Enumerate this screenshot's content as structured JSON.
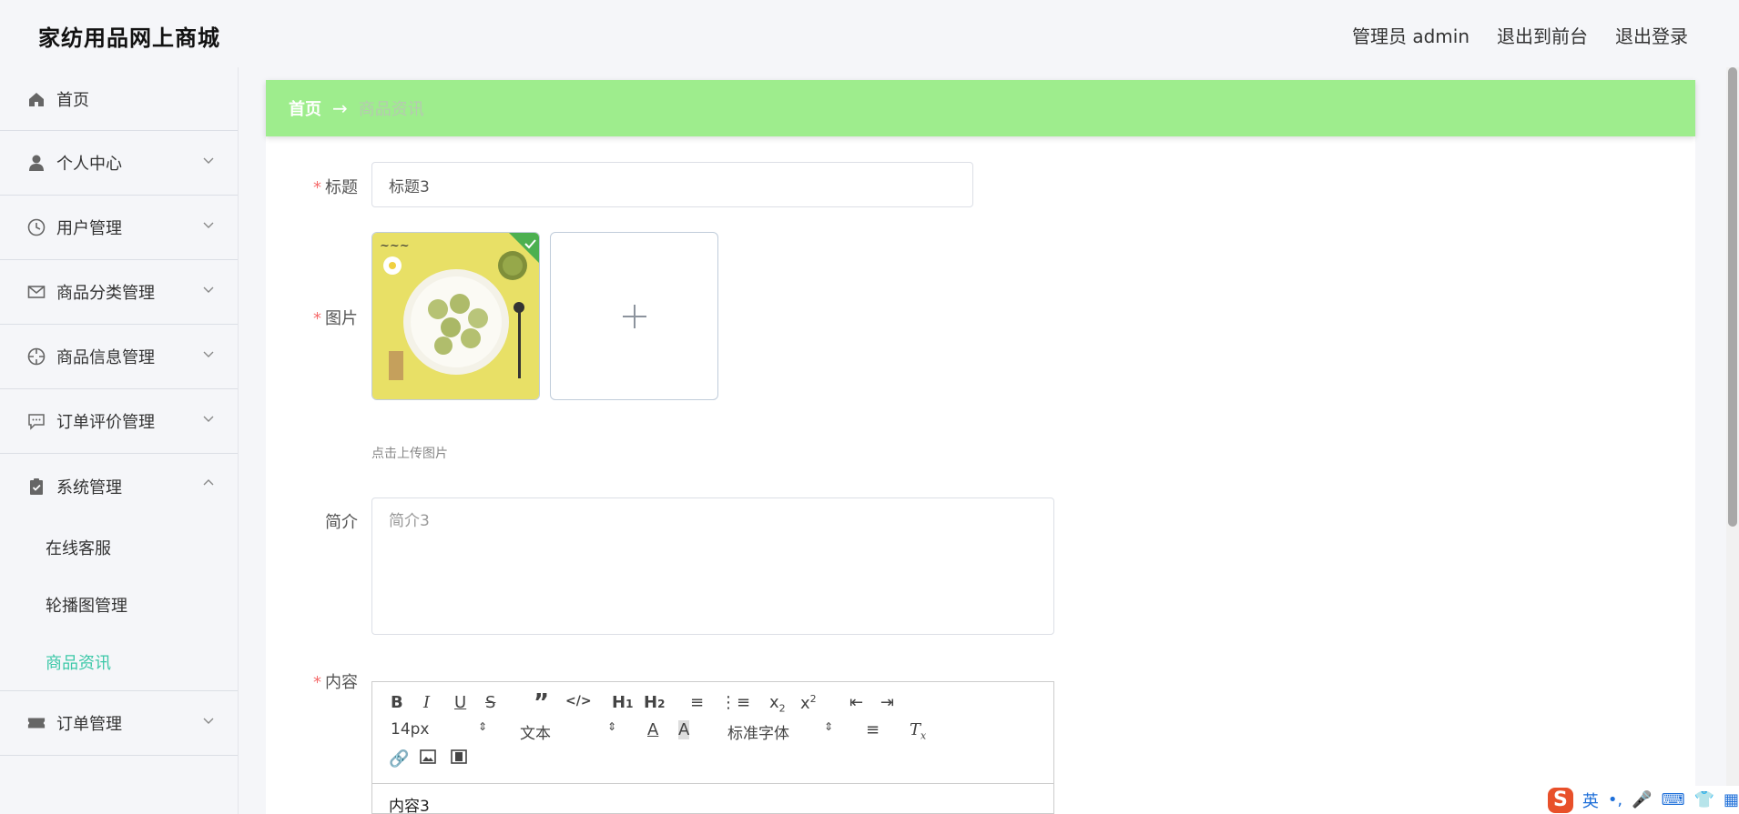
{
  "header": {
    "title": "家纺用品网上商城",
    "admin_label": "管理员 admin",
    "front_label": "退出到前台",
    "logout_label": "退出登录"
  },
  "sidebar": {
    "items": [
      {
        "label": "首页",
        "icon": "home-icon"
      },
      {
        "label": "个人中心",
        "icon": "user-icon"
      },
      {
        "label": "用户管理",
        "icon": "clock-icon"
      },
      {
        "label": "商品分类管理",
        "icon": "mail-icon"
      },
      {
        "label": "商品信息管理",
        "icon": "target-icon"
      },
      {
        "label": "订单评价管理",
        "icon": "chat-icon"
      },
      {
        "label": "系统管理",
        "icon": "clipboard-icon"
      },
      {
        "label": "订单管理",
        "icon": "ticket-icon"
      }
    ],
    "sub_items": [
      "在线客服",
      "轮播图管理",
      "商品资讯"
    ],
    "active_sub": "商品资讯"
  },
  "breadcrumb": {
    "home": "首页",
    "separator": "→",
    "current": "商品资讯"
  },
  "form": {
    "title_label": "标题",
    "title_value": "标题3",
    "image_label": "图片",
    "upload_hint": "点击上传图片",
    "intro_label": "简介",
    "intro_value": "简介3",
    "content_label": "内容",
    "content_value": "内容3"
  },
  "editor": {
    "font_size": "14px",
    "paragraph": "文本",
    "font_family": "标准字体",
    "buttons": [
      "bold-icon",
      "italic-icon",
      "underline-icon",
      "strike-icon",
      "quote-icon",
      "code-icon",
      "h1-icon",
      "h2-icon",
      "ordered-list-icon",
      "bullet-list-icon",
      "subscript-icon",
      "superscript-icon",
      "outdent-icon",
      "indent-icon",
      "font-color-icon",
      "bg-color-icon",
      "align-icon",
      "clear-format-icon",
      "link-icon",
      "image-icon",
      "video-icon"
    ]
  },
  "ime": {
    "lang": "英",
    "punct": "•,"
  },
  "colors": {
    "breadcrumb_bg": "#9eed8d",
    "active_menu": "#3cc8a8",
    "required": "#f56c6c"
  }
}
